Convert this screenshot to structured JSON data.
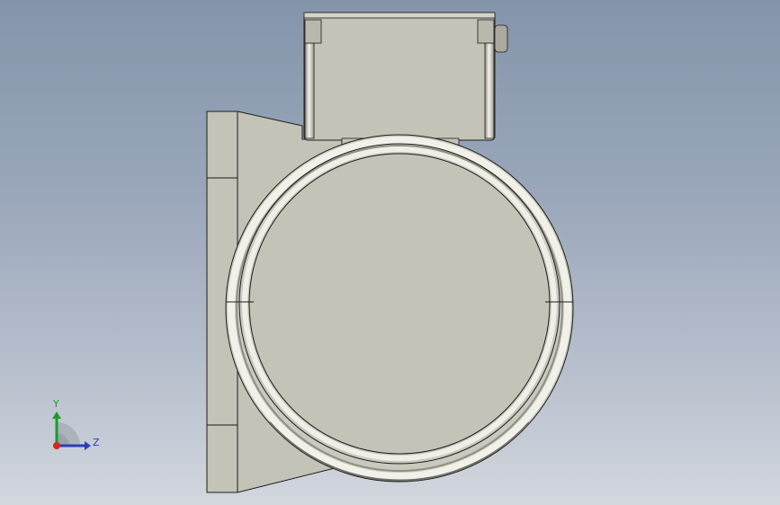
{
  "viewport": {
    "background_top": "#8494aa",
    "background_bottom": "#d3d7de"
  },
  "model": {
    "part_color": "#c3c3b8",
    "edge_color": "#1e1e1a",
    "ring_color": "#d6d6cc",
    "shadow_color": "#8c8c82"
  },
  "triad": {
    "y_label": "Y",
    "z_label": "Z",
    "y_color": "#1f9a2b",
    "z_color": "#2b3fb8",
    "origin_color": "#d12a1e"
  }
}
